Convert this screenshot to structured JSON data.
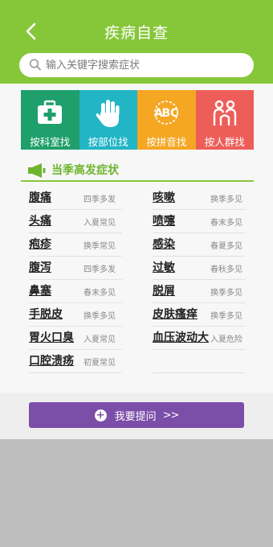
{
  "header": {
    "title": "疾病自查"
  },
  "search": {
    "placeholder": "输入关键字搜索症状"
  },
  "categories": [
    {
      "label": "按科室找",
      "color": "#1e9f6b",
      "icon": "medical-kit-icon"
    },
    {
      "label": "按部位找",
      "color": "#22b5c6",
      "icon": "hand-icon"
    },
    {
      "label": "按拼音找",
      "color": "#f5a623",
      "icon": "abc-icon"
    },
    {
      "label": "按人群找",
      "color": "#ee5e59",
      "icon": "people-icon"
    }
  ],
  "section": {
    "title": "当季高发症状"
  },
  "left_items": [
    {
      "name": "腹痛",
      "season": "四季多发"
    },
    {
      "name": "头痛",
      "season": "入夏常见"
    },
    {
      "name": "疱疹",
      "season": "换季常见"
    },
    {
      "name": "腹泻",
      "season": "四季多发"
    },
    {
      "name": "鼻塞",
      "season": "春末多见"
    },
    {
      "name": "手脱皮",
      "season": "换季多见"
    },
    {
      "name": "胃火口臭",
      "season": "入夏常见"
    },
    {
      "name": "口腔溃疡",
      "season": "初夏常见"
    }
  ],
  "right_items": [
    {
      "name": "咳嗽",
      "season": "换季多见"
    },
    {
      "name": "喷嚏",
      "season": "春末多见"
    },
    {
      "name": "感染",
      "season": "春夏多见"
    },
    {
      "name": "过敏",
      "season": "春秋多见"
    },
    {
      "name": "脱屑",
      "season": "换季多见"
    },
    {
      "name": "皮肤瘙痒",
      "season": "换季多见"
    },
    {
      "name": "血压波动大",
      "season": "入夏危险"
    },
    {
      "name": "",
      "season": ""
    }
  ],
  "ask_button": {
    "label": "我要提问",
    "arrow": ">>"
  },
  "colors": {
    "header": "#86c73a",
    "button": "#7b4ea8"
  }
}
